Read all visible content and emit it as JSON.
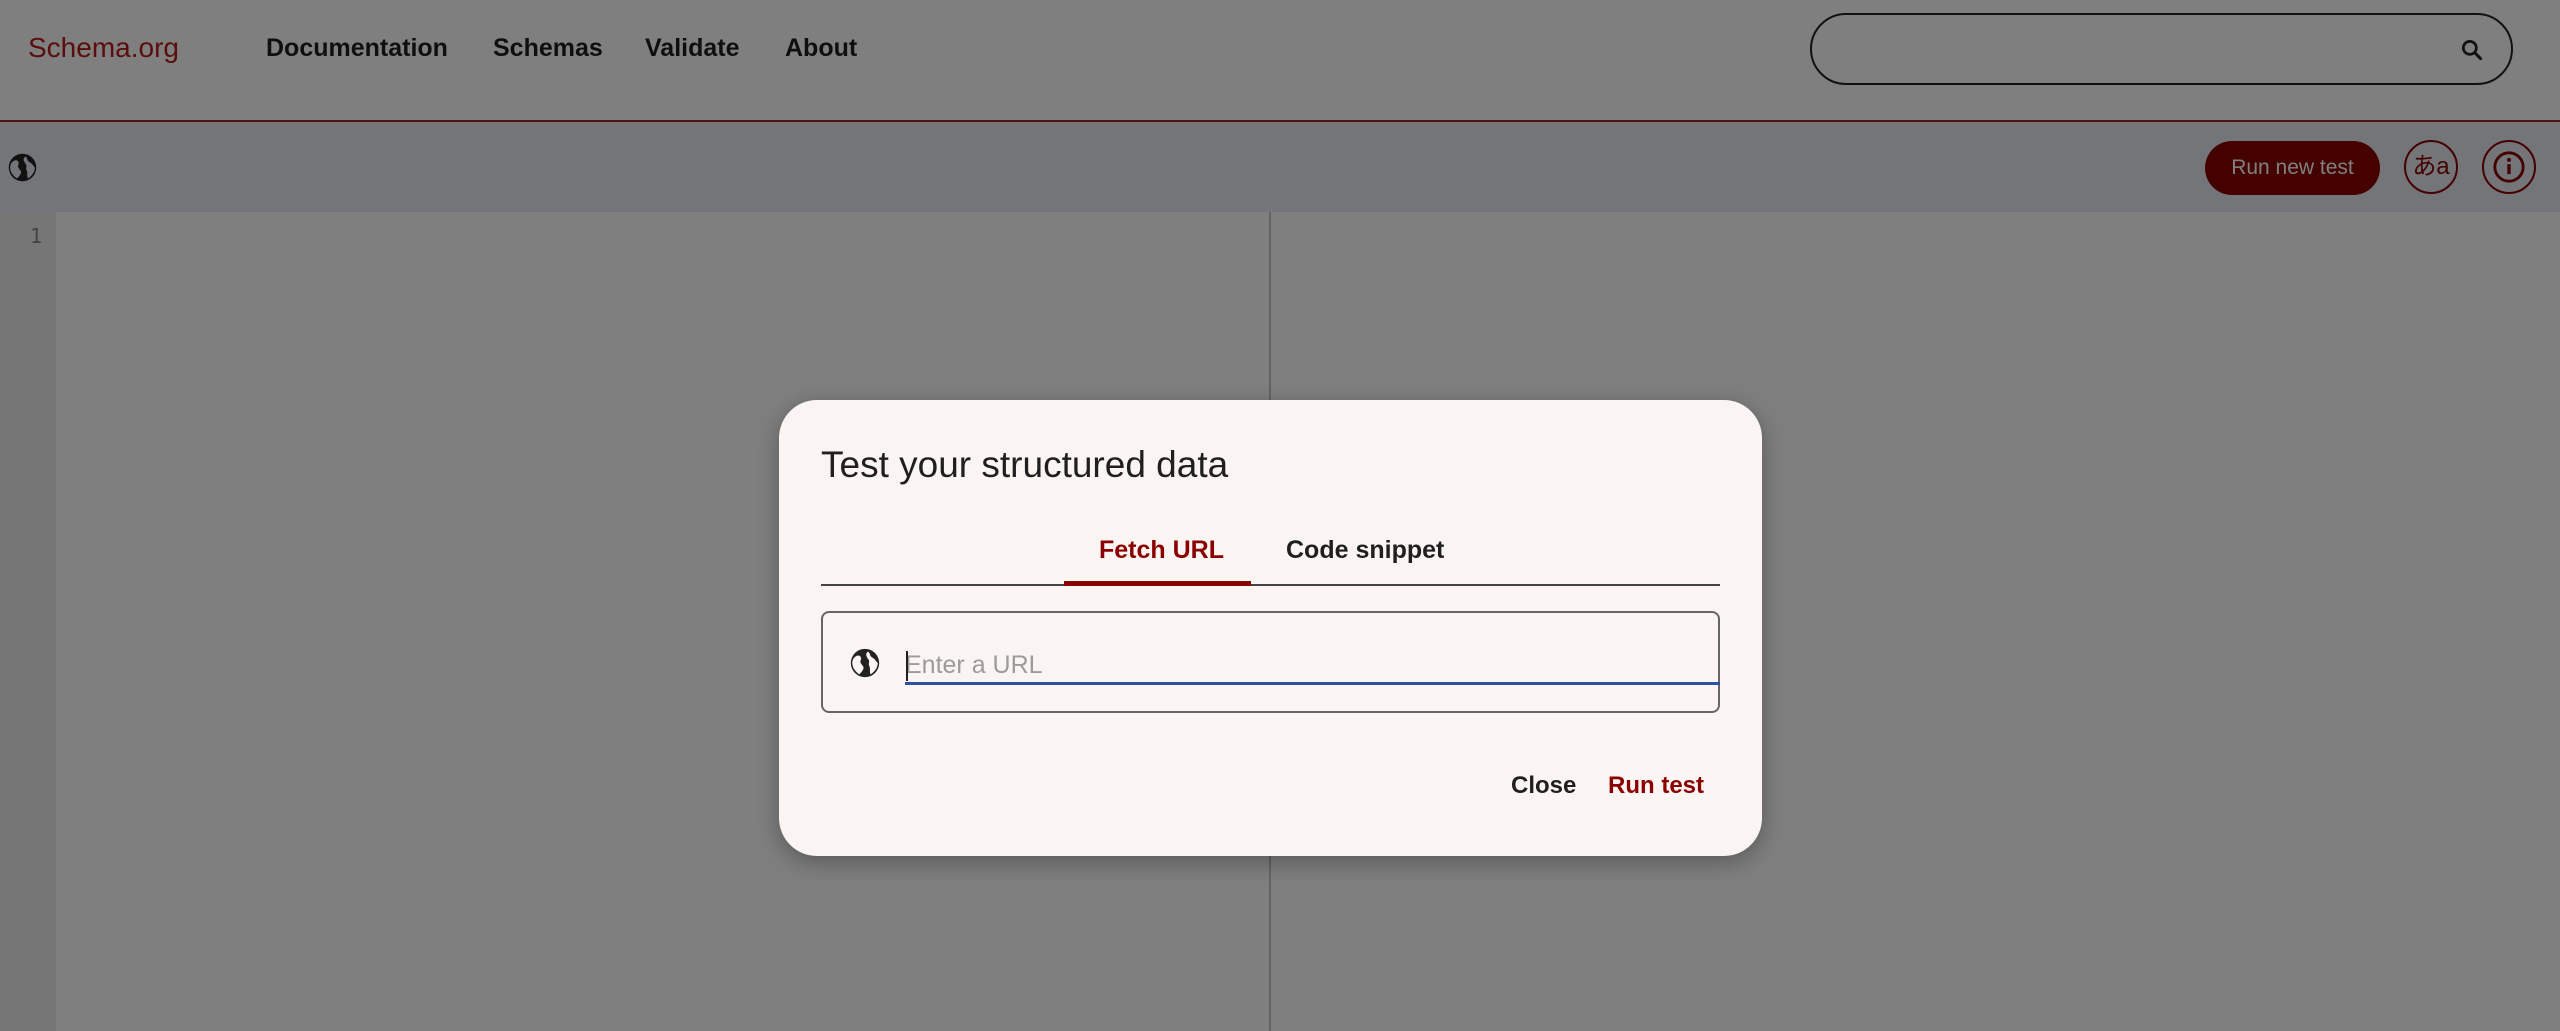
{
  "header": {
    "logo": "Schema.org",
    "nav": [
      "Documentation",
      "Schemas",
      "Validate",
      "About"
    ],
    "search_icon": "search-icon"
  },
  "toolbar": {
    "globe_icon": "globe-icon",
    "run_new_test_label": "Run new test",
    "language_button_label": "あa",
    "info_icon": "info-icon"
  },
  "editor": {
    "line_numbers": [
      "1"
    ]
  },
  "dialog": {
    "title": "Test your structured data",
    "tabs": [
      {
        "label": "Fetch URL",
        "active": true
      },
      {
        "label": "Code snippet",
        "active": false
      }
    ],
    "url_input": {
      "placeholder": "Enter a URL",
      "value": "",
      "icon": "globe-icon"
    },
    "close_label": "Close",
    "run_label": "Run test"
  },
  "colors": {
    "brand": "#8b0000",
    "overlay": "rgba(0,0,0,0.5)",
    "dialog_bg": "#faf4f3",
    "input_underline": "#2f4f9f"
  }
}
